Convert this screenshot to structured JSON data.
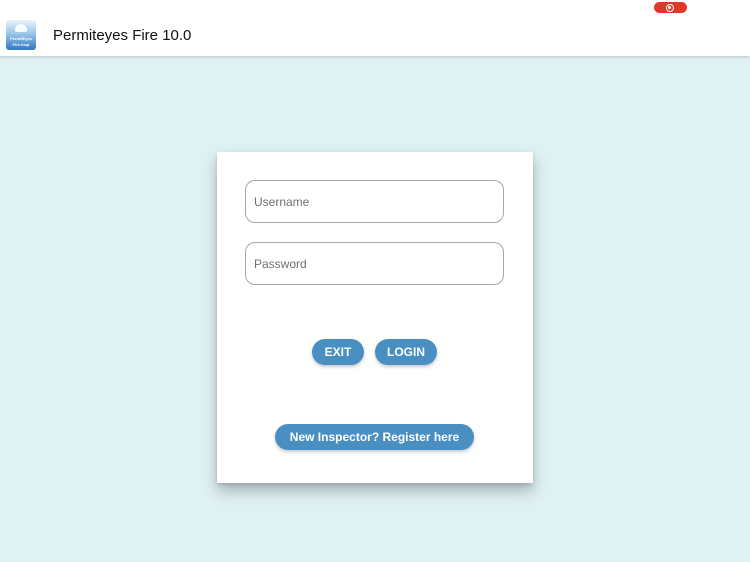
{
  "app": {
    "title": "Permiteyes Fire 10.0",
    "logo_line1": "PermitEyes",
    "logo_line2": "Fire Insp"
  },
  "login": {
    "username_placeholder": "Username",
    "password_placeholder": "Password",
    "exit_label": "EXIT",
    "login_label": "LOGIN",
    "register_label": "New Inspector? Register here"
  },
  "status": {
    "recording_icon": "screen-record-icon"
  },
  "colors": {
    "background": "#dff1f3",
    "button": "#4a8fc2",
    "recording": "#e0362c"
  }
}
